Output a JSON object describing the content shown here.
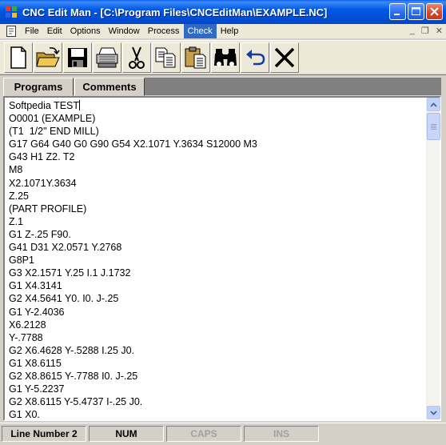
{
  "window": {
    "title": "CNC Edit Man - [C:\\Program Files\\CNCEditMan\\EXAMPLE.NC]"
  },
  "menu": {
    "items": [
      "File",
      "Edit",
      "Options",
      "Window",
      "Process",
      "Check",
      "Help"
    ],
    "active": "Check"
  },
  "toolbar": {
    "buttons": [
      "new-file",
      "open-folder",
      "save-disk",
      "print",
      "cut-scissors",
      "copy",
      "paste",
      "find-binoculars",
      "undo-arrow",
      "delete-x"
    ]
  },
  "tabs": {
    "programs": "Programs",
    "comments": "Comments"
  },
  "editor": {
    "lines": [
      "Softpedia TEST",
      "O0001 (EXAMPLE)",
      "(T1  1/2\" END MILL)",
      "G17 G64 G40 G0 G90 G54 X2.1071 Y.3634 S12000 M3",
      "G43 H1 Z2. T2",
      "M8",
      "X2.1071Y.3634",
      "Z.25",
      "(PART PROFILE)",
      "Z.1",
      "G1 Z-.25 F90.",
      "G41 D31 X2.0571 Y.2768",
      "G8P1",
      "G3 X2.1571 Y.25 I.1 J.1732",
      "G1 X4.3141",
      "G2 X4.5641 Y0. I0. J-.25",
      "G1 Y-2.4036",
      "X6.2128",
      "Y-.7788",
      "G2 X6.4628 Y-.5288 I.25 J0.",
      "G1 X8.6115",
      "G2 X8.8615 Y-.7788 I0. J-.25",
      "G1 Y-5.2237",
      "G2 X8.6115 Y-5.4737 I-.25 J0.",
      "G1 X0."
    ]
  },
  "status": {
    "line_number": "Line Number 2",
    "num": "NUM",
    "caps": "CAPS",
    "ins": "INS"
  },
  "colors": {
    "titlebar": "#0054e3",
    "menu_highlight": "#316ac5",
    "face": "#d4d0c8"
  }
}
